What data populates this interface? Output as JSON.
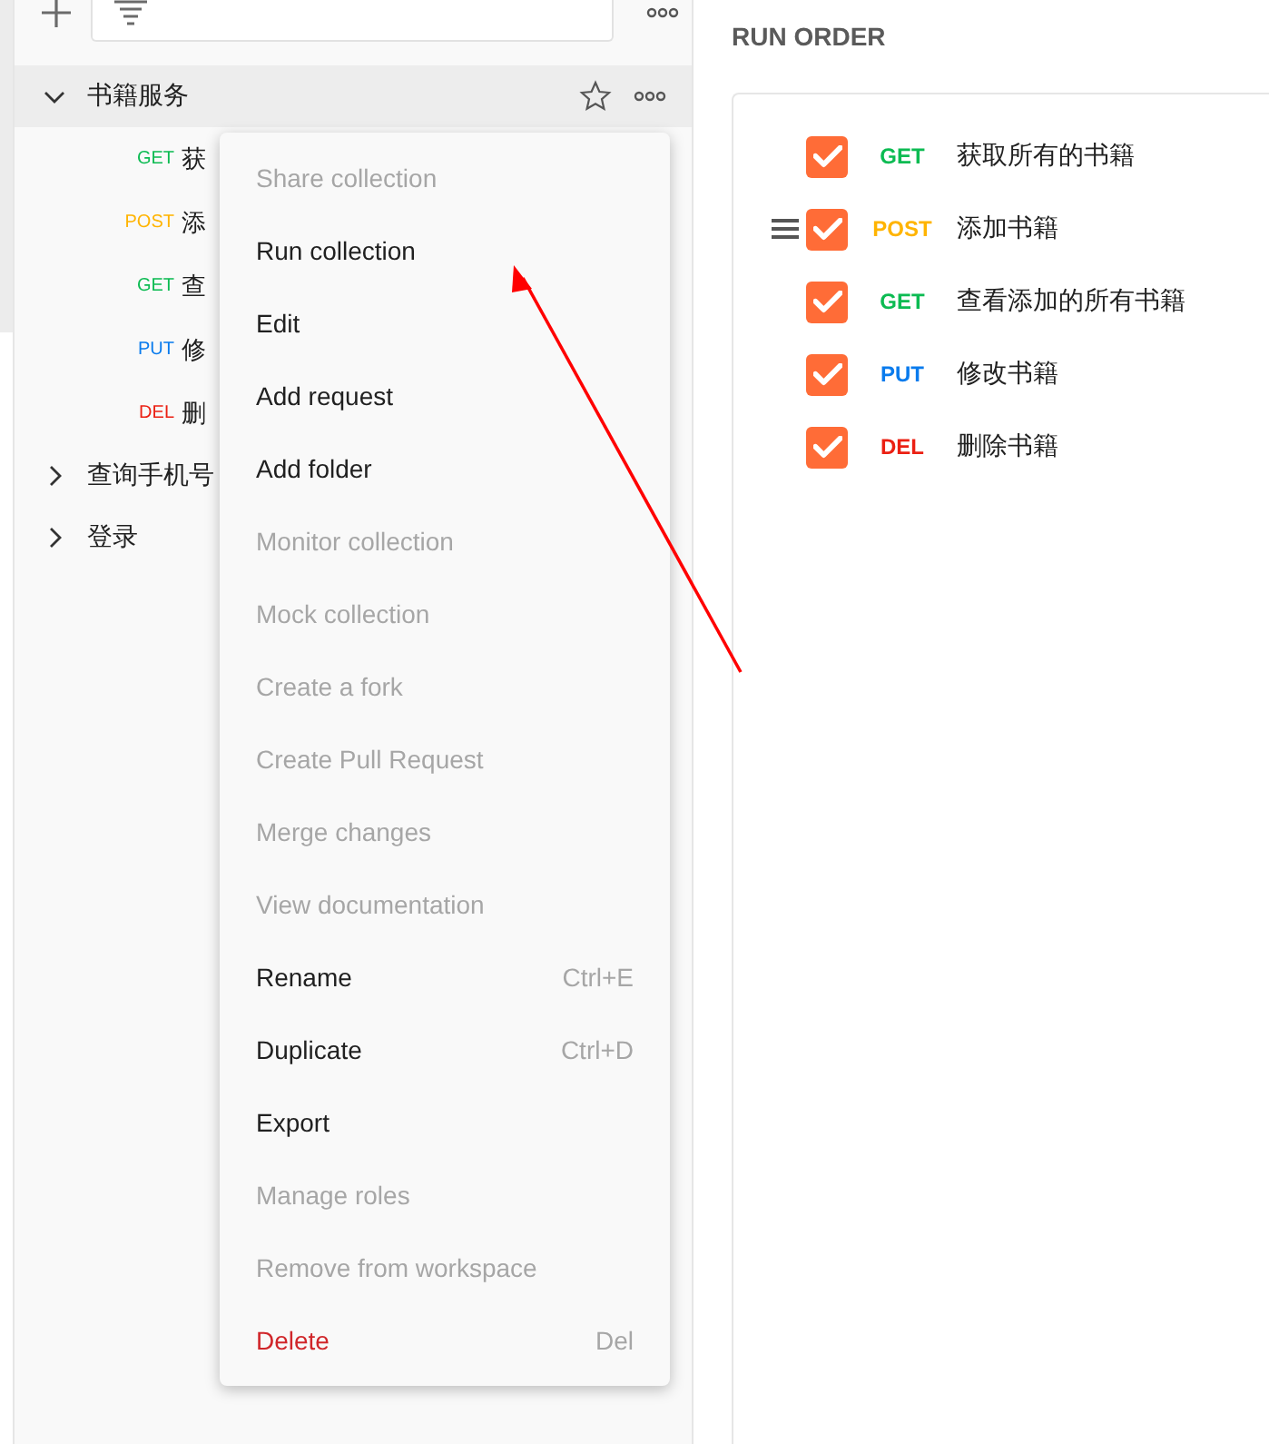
{
  "sidebar": {
    "collections": [
      {
        "name": "书籍服务",
        "expanded": true,
        "active": true,
        "requests": [
          {
            "method": "GET",
            "color": "#0cbb52",
            "name": "获"
          },
          {
            "method": "POST",
            "color": "#ffb400",
            "name": "添"
          },
          {
            "method": "GET",
            "color": "#0cbb52",
            "name": "查"
          },
          {
            "method": "PUT",
            "color": "#097bed",
            "name": "修"
          },
          {
            "method": "DEL",
            "color": "#eb2013",
            "name": "删"
          }
        ]
      },
      {
        "name": "查询手机号",
        "expanded": false,
        "active": false
      },
      {
        "name": "登录",
        "expanded": false,
        "active": false
      }
    ]
  },
  "context_menu": {
    "items": [
      {
        "label": "Share collection",
        "disabled": true,
        "kind": "normal"
      },
      {
        "label": "Run collection",
        "disabled": false,
        "kind": "normal"
      },
      {
        "label": "Edit",
        "disabled": false,
        "kind": "normal"
      },
      {
        "label": "Add request",
        "disabled": false,
        "kind": "normal"
      },
      {
        "label": "Add folder",
        "disabled": false,
        "kind": "normal"
      },
      {
        "label": "Monitor collection",
        "disabled": true,
        "kind": "normal"
      },
      {
        "label": "Mock collection",
        "disabled": true,
        "kind": "normal"
      },
      {
        "label": "Create a fork",
        "disabled": true,
        "kind": "normal"
      },
      {
        "label": "Create Pull Request",
        "disabled": true,
        "kind": "normal"
      },
      {
        "label": "Merge changes",
        "disabled": true,
        "kind": "normal"
      },
      {
        "label": "View documentation",
        "disabled": true,
        "kind": "normal"
      },
      {
        "label": "Rename",
        "shortcut": "Ctrl+E",
        "disabled": false,
        "kind": "normal"
      },
      {
        "label": "Duplicate",
        "shortcut": "Ctrl+D",
        "disabled": false,
        "kind": "normal"
      },
      {
        "label": "Export",
        "disabled": false,
        "kind": "normal"
      },
      {
        "label": "Manage roles",
        "disabled": true,
        "kind": "normal"
      },
      {
        "label": "Remove from workspace",
        "disabled": true,
        "kind": "normal"
      },
      {
        "label": "Delete",
        "shortcut": "Del",
        "disabled": false,
        "kind": "danger"
      }
    ]
  },
  "run_order": {
    "title": "RUN ORDER",
    "items": [
      {
        "method": "GET",
        "color": "#0cbb52",
        "name": "获取所有的书籍",
        "checked": true,
        "hovered": false
      },
      {
        "method": "POST",
        "color": "#ffb400",
        "name": "添加书籍",
        "checked": true,
        "hovered": true
      },
      {
        "method": "GET",
        "color": "#0cbb52",
        "name": "查看添加的所有书籍",
        "checked": true,
        "hovered": false
      },
      {
        "method": "PUT",
        "color": "#097bed",
        "name": "修改书籍",
        "checked": true,
        "hovered": false
      },
      {
        "method": "DEL",
        "color": "#eb2013",
        "name": "删除书籍",
        "checked": true,
        "hovered": false
      }
    ]
  }
}
